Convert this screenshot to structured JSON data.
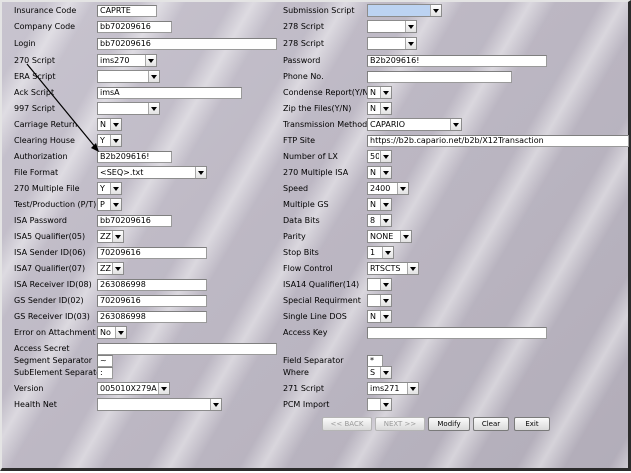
{
  "labels": {
    "insurance_code": "Insurance Code",
    "company_code": "Company Code",
    "login": "Login",
    "script_270": "270 Script",
    "era_script": "ERA Script",
    "ack_script": "Ack Script",
    "script_997": "997 Script",
    "carriage_return": "Carriage Return",
    "clearing_house": "Clearing House",
    "authorization": "Authorization",
    "file_format": "File Format",
    "multiple_file_270": "270 Multiple File",
    "test_production": "Test/Production (P/T)",
    "isa_password": "ISA Password",
    "isa5_qualifier": "ISA5 Qualifier(05)",
    "isa_sender_id": "ISA Sender ID(06)",
    "isa7_qualifier": "ISA7 Qualifier(07)",
    "isa_receiver_id": "ISA Receiver ID(08)",
    "gs_sender_id": "GS Sender ID(02)",
    "gs_receiver_id": "GS Receiver ID(03)",
    "error_on_attachment": "Error on Attachment",
    "access_secret": "Access Secret",
    "segment_separator": "Segment Separator",
    "subelement_separator": "SubElement Separator",
    "version": "Version",
    "health_net": "Health Net",
    "submission_script": "Submission Script",
    "script_278_a": "278 Script",
    "script_278_b": "278 Script",
    "password": "Password",
    "phone_no": "Phone No.",
    "condense_report": "Condense Report(Y/N)",
    "zip_files": "Zip the Files(Y/N)",
    "transmission_method": "Transmission Method",
    "ftp_site": "FTP Site",
    "number_of_lx": "Number of LX",
    "multiple_isa_270": "270 Multiple ISA",
    "speed": "Speed",
    "multiple_gs": "Multiple GS",
    "data_bits": "Data Bits",
    "parity": "Parity",
    "stop_bits": "Stop Bits",
    "flow_control": "Flow Control",
    "isa14_qualifier": "ISA14 Qualifier(14)",
    "special_requirement": "Special Requirment",
    "single_line_dos": "Single Line DOS",
    "access_key": "Access Key",
    "field_separator": "Field Separator",
    "where": "Where",
    "script_271": "271 Script",
    "pcm_import": "PCM Import"
  },
  "values": {
    "insurance_code": "CAPRTE",
    "company_code": "bb70209616",
    "login": "bb70209616",
    "script_270": "ims270",
    "era_script": "",
    "ack_script": "imsA",
    "script_997": "",
    "carriage_return": "N",
    "clearing_house": "Y",
    "authorization": "B2b209616!",
    "file_format": "<SEQ>.txt",
    "multiple_file_270": "Y",
    "test_production": "P",
    "isa_password": "bb70209616",
    "isa5_qualifier": "ZZ",
    "isa_sender_id": "70209616",
    "isa7_qualifier": "ZZ",
    "isa_receiver_id": "263086998",
    "gs_sender_id": "70209616",
    "gs_receiver_id": "263086998",
    "error_on_attachment": "No",
    "access_secret": "",
    "segment_separator": "~",
    "subelement_separator": ":",
    "version": "005010X279A1",
    "health_net": "",
    "submission_script": "",
    "script_278_a": "",
    "script_278_b": "",
    "password": "B2b209616!",
    "phone_no": "",
    "condense_report": "N",
    "zip_files": "N",
    "transmission_method": "CAPARIO",
    "ftp_site": "https://b2b.capario.net/b2b/X12Transaction",
    "number_of_lx": "50",
    "multiple_isa_270": "N",
    "speed": "2400",
    "multiple_gs": "N",
    "data_bits": "8",
    "parity": "NONE",
    "stop_bits": "1",
    "flow_control": "RTSCTS",
    "isa14_qualifier": "",
    "special_requirement": "",
    "single_line_dos": "N",
    "access_key": "",
    "field_separator": "*",
    "where": "S",
    "script_271": "ims271",
    "pcm_import": ""
  },
  "buttons": {
    "back": "<< BACK",
    "next": "NEXT >>",
    "modify": "Modify",
    "clear": "Clear",
    "exit": "Exit"
  },
  "colors": {
    "background": "#bdb8c4",
    "highlight": "#bcd3f2"
  }
}
